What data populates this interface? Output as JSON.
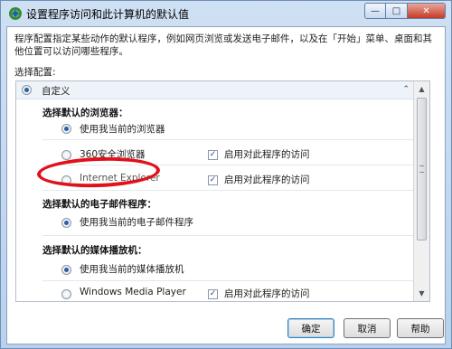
{
  "window": {
    "title": "设置程序访问和此计算机的默认值",
    "controls": {
      "minimize": "—",
      "maximize": "□",
      "close": "✕"
    }
  },
  "description": "程序配置指定某些动作的默认程序，例如网页浏览或发送电子邮件，以及在「开始」菜单、桌面和其他位置可以访问哪些程序。",
  "config_label": "选择配置:",
  "config_header": {
    "label": "自定义",
    "selected": true,
    "collapse_glyph": "⌃"
  },
  "sections": [
    {
      "title": "选择默认的浏览器：",
      "options": [
        {
          "label": "使用我当前的浏览器",
          "selected": true
        },
        {
          "label": "360安全浏览器",
          "selected": false,
          "enable_access_label": "启用对此程序的访问",
          "enable_access_checked": true
        },
        {
          "label": "Internet Explorer",
          "selected": false,
          "enable_access_label": "启用对此程序的访问",
          "enable_access_checked": true
        }
      ]
    },
    {
      "title": "选择默认的电子邮件程序：",
      "options": [
        {
          "label": "使用我当前的电子邮件程序",
          "selected": true
        }
      ]
    },
    {
      "title": "选择默认的媒体播放机：",
      "options": [
        {
          "label": "使用我当前的媒体播放机",
          "selected": true
        },
        {
          "label": "Windows Media Player",
          "selected": false,
          "enable_access_label": "启用对此程序的访问",
          "enable_access_checked": true
        }
      ]
    }
  ],
  "buttons": {
    "ok": "确定",
    "cancel": "取消",
    "help": "帮助"
  },
  "icons": {
    "title": "default-programs-icon",
    "check": "✓"
  },
  "colors": {
    "annotation": "#e0111a",
    "accent": "#2a5ea8"
  }
}
